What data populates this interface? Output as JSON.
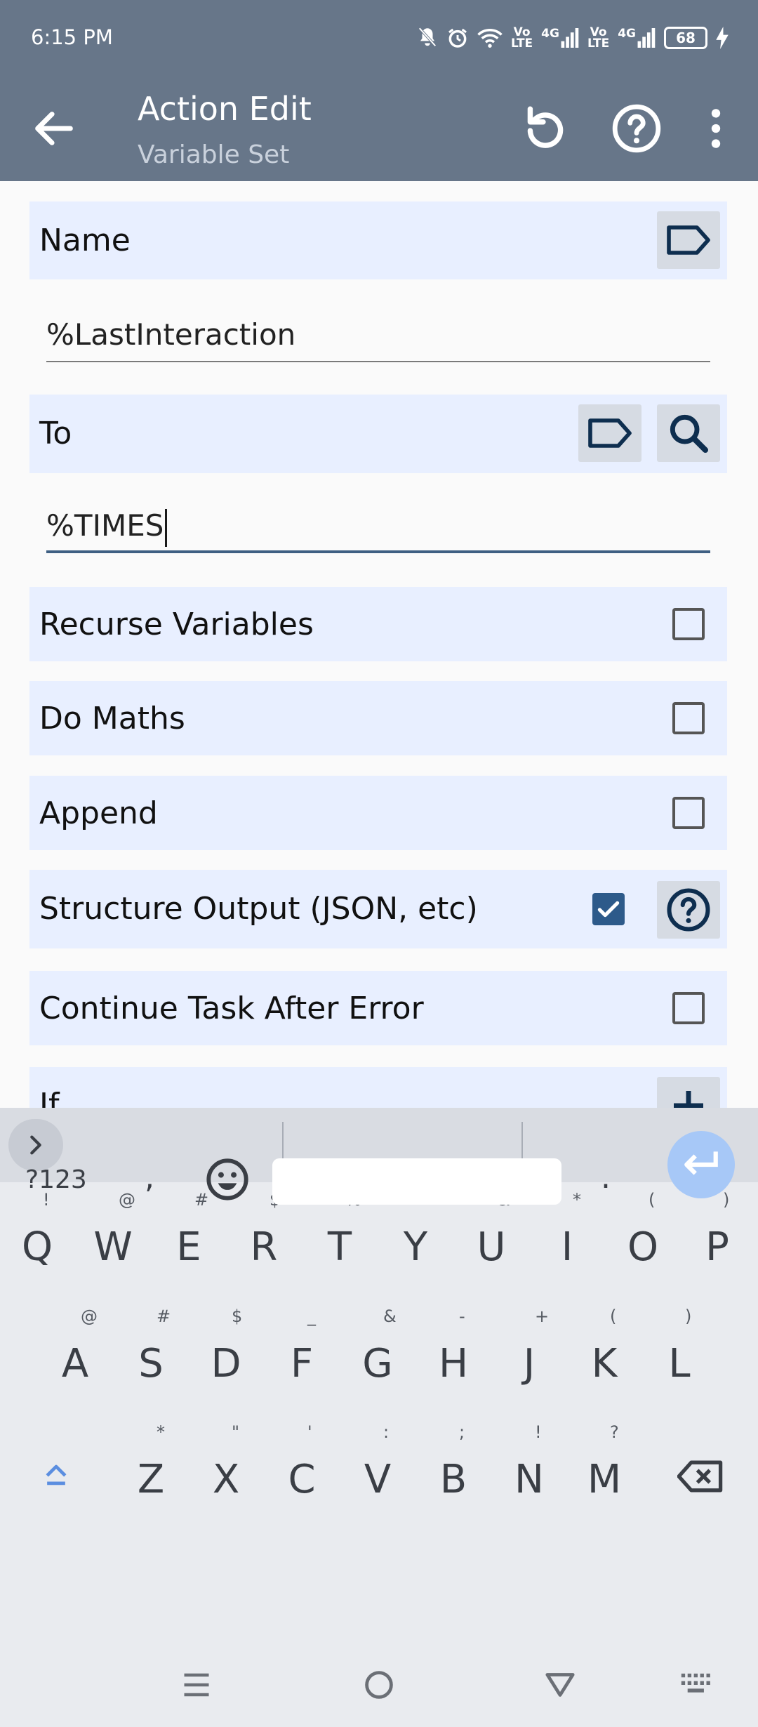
{
  "status_bar": {
    "time": "6:15 PM",
    "vo_lte_1": "Vo\nLTE",
    "net_1": "4G",
    "vo_lte_2": "Vo\nLTE",
    "net_2": "4G",
    "battery": "68"
  },
  "app_bar": {
    "title": "Action Edit",
    "subtitle": "Variable Set",
    "icons": [
      "back-arrow-icon",
      "reset-icon",
      "help-icon",
      "more-vert-icon"
    ]
  },
  "form": {
    "name_label": "Name",
    "name_value": "%LastInteraction",
    "to_label": "To",
    "to_value": "%TIMES",
    "options": [
      {
        "label": "Recurse Variables",
        "checked": false
      },
      {
        "label": "Do Maths",
        "checked": false
      },
      {
        "label": "Append",
        "checked": false
      },
      {
        "label": "Structure Output (JSON, etc)",
        "checked": true
      },
      {
        "label": "Continue Task After Error",
        "checked": false
      }
    ],
    "if_label": "If"
  },
  "keyboard": {
    "row1": [
      {
        "key": "Q",
        "alt": "!"
      },
      {
        "key": "W",
        "alt": "@"
      },
      {
        "key": "E",
        "alt": "#"
      },
      {
        "key": "R",
        "alt": "$"
      },
      {
        "key": "T",
        "alt": "%"
      },
      {
        "key": "Y",
        "alt": "^"
      },
      {
        "key": "U",
        "alt": "&"
      },
      {
        "key": "I",
        "alt": "*"
      },
      {
        "key": "O",
        "alt": "("
      },
      {
        "key": "P",
        "alt": ")"
      }
    ],
    "row2": [
      {
        "key": "A",
        "alt": "@"
      },
      {
        "key": "S",
        "alt": "#"
      },
      {
        "key": "D",
        "alt": "$"
      },
      {
        "key": "F",
        "alt": "_"
      },
      {
        "key": "G",
        "alt": "&"
      },
      {
        "key": "H",
        "alt": "-"
      },
      {
        "key": "J",
        "alt": "+"
      },
      {
        "key": "K",
        "alt": "("
      },
      {
        "key": "L",
        "alt": ")"
      }
    ],
    "row3": [
      {
        "key": "Z",
        "alt": "*"
      },
      {
        "key": "X",
        "alt": "\""
      },
      {
        "key": "C",
        "alt": "'"
      },
      {
        "key": "V",
        "alt": ":"
      },
      {
        "key": "B",
        "alt": ";"
      },
      {
        "key": "N",
        "alt": "!"
      },
      {
        "key": "M",
        "alt": "?"
      }
    ],
    "symbols_label": "?123",
    "comma": ",",
    "period": "."
  },
  "colors": {
    "app_bar": "#677689",
    "row_bg": "#e8efff",
    "accent": "#2d5a8a",
    "enter_key": "#a7c8f7"
  }
}
